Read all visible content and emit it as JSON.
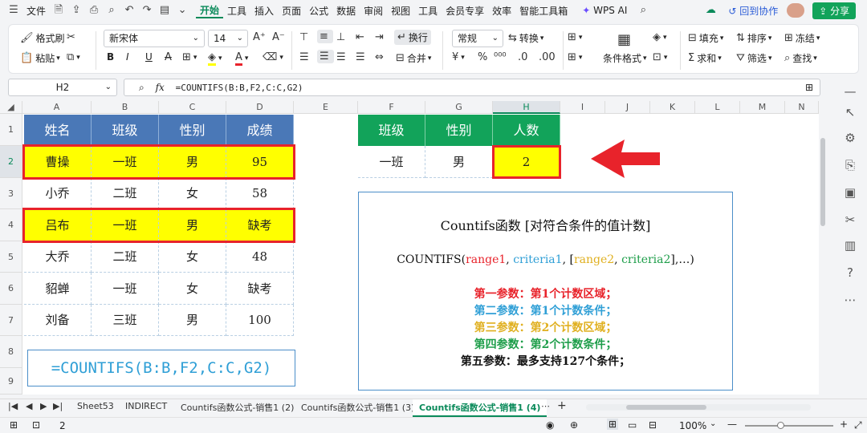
{
  "menu": {
    "file": "文件",
    "tabs": [
      "开始",
      "工具",
      "插入",
      "页面",
      "公式",
      "数据",
      "审阅",
      "视图",
      "工具",
      "会员专享",
      "效率",
      "智能工具箱"
    ],
    "wps_ai": "WPS AI",
    "back_collab": "回到协作",
    "share": "分享"
  },
  "ribbon": {
    "format_painter": "格式刷",
    "paste": "粘贴",
    "font_name": "新宋体",
    "font_size": "14",
    "wrap": "换行",
    "number_format": "常规",
    "convert": "转换",
    "merge": "合并",
    "cond_format": "条件格式",
    "fill": "填充",
    "sort": "排序",
    "freeze": "冻结",
    "sum": "求和",
    "filter": "筛选",
    "find": "查找",
    "bold": "B",
    "italic": "I",
    "underline": "U"
  },
  "formula_bar": {
    "name_box": "H2",
    "fx": "fx",
    "formula": "=COUNTIFS(B:B,F2,C:C,G2)"
  },
  "columns": [
    "A",
    "B",
    "C",
    "D",
    "E",
    "F",
    "G",
    "H",
    "I",
    "J",
    "K",
    "L",
    "M",
    "N"
  ],
  "rows": [
    "1",
    "2",
    "3",
    "4",
    "5",
    "6",
    "7",
    "8",
    "9"
  ],
  "table": {
    "headers": [
      "姓名",
      "班级",
      "性别",
      "成绩"
    ],
    "rows": [
      [
        "曹操",
        "一班",
        "男",
        "95"
      ],
      [
        "小乔",
        "二班",
        "女",
        "58"
      ],
      [
        "吕布",
        "一班",
        "男",
        "缺考"
      ],
      [
        "大乔",
        "二班",
        "女",
        "48"
      ],
      [
        "貂蝉",
        "一班",
        "女",
        "缺考"
      ],
      [
        "刘备",
        "三班",
        "男",
        "100"
      ]
    ]
  },
  "formula_note": "=COUNTIFS(B:B,F2,C:C,G2)",
  "criteria": {
    "headers": [
      "班级",
      "性别",
      "人数"
    ],
    "values": [
      "一班",
      "男",
      "2"
    ]
  },
  "explain": {
    "title": "Countifs函数 [对符合条件的值计数]",
    "syntax": {
      "func": "COUNTIFS(",
      "range1": "range1",
      "c1": ",  ",
      "criteria1": "criteria1",
      "c2": ",  [",
      "range2": "range2",
      "c3": ",  ",
      "criteria2": "criteria2",
      "end": "],…)"
    },
    "lines": [
      "第一参数：第1个计数区域；",
      "第二参数：第1个计数条件；",
      "第三参数：第2个计数区域；",
      "第四参数：第2个计数条件；",
      "第五参数：最多支持127个条件；"
    ],
    "colors": [
      "#e8232b",
      "#2f9fd6",
      "#e0b020",
      "#1e9e4a",
      "#111111"
    ]
  },
  "sheet_tabs": [
    "Sheet53",
    "INDIRECT",
    "Countifs函数公式-销售1 (2)",
    "Countifs函数公式-销售1 (3)",
    "Countifs函数公式-销售1 (4)"
  ],
  "more_tabs": "⋯",
  "status": {
    "count": "2",
    "zoom": "100%"
  }
}
